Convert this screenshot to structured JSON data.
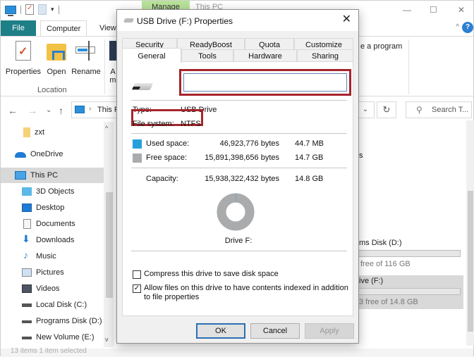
{
  "explorer": {
    "title_tab_contextual": "Manage",
    "title": "This PC",
    "quick_access_icons": [
      "this-pc-icon",
      "properties-icon",
      "new-folder-icon",
      "customize-qat-icon"
    ],
    "window_controls": {
      "minimize": "—",
      "maximize": "☐",
      "close": "✕"
    },
    "ribbon_tabs": [
      {
        "label": "File"
      },
      {
        "label": "Computer",
        "active": true
      },
      {
        "label": "View"
      }
    ],
    "ribbon": {
      "buttons": [
        {
          "label": "Properties",
          "icon": "properties-icon"
        },
        {
          "label": "Open",
          "icon": "open-folder-icon"
        },
        {
          "label": "Rename",
          "icon": "rename-icon"
        }
      ],
      "truncated_buttons": [
        "A",
        "m"
      ],
      "group_label": "Location",
      "program_text": "e a program"
    },
    "nav": {
      "back": "←",
      "forward": "→",
      "recent": "⌄",
      "up": "↑",
      "address_chevron": "›",
      "address_text": "This P",
      "address_dropdown": "⌄",
      "refresh": "↻",
      "search_placeholder": "Search T..."
    },
    "sidebar": {
      "items": [
        {
          "label": "zxt",
          "icon": "folder-icon"
        },
        {
          "label": "OneDrive",
          "icon": "onedrive-icon"
        },
        {
          "label": "This PC",
          "icon": "this-pc-icon",
          "selected": true
        },
        {
          "label": "3D Objects",
          "icon": "3d-objects-icon"
        },
        {
          "label": "Desktop",
          "icon": "desktop-icon"
        },
        {
          "label": "Documents",
          "icon": "documents-icon"
        },
        {
          "label": "Downloads",
          "icon": "downloads-icon"
        },
        {
          "label": "Music",
          "icon": "music-icon"
        },
        {
          "label": "Pictures",
          "icon": "pictures-icon"
        },
        {
          "label": "Videos",
          "icon": "videos-icon"
        },
        {
          "label": "Local Disk (C:)",
          "icon": "local-disk-icon"
        },
        {
          "label": "Programs Disk (D:)",
          "icon": "drive-icon"
        },
        {
          "label": "New Volume (E:)",
          "icon": "drive-icon"
        }
      ],
      "scroll_up": "^",
      "scroll_down": "v"
    },
    "main": {
      "partial_s": "s",
      "drives": [
        {
          "name": "ms Disk (D:)",
          "free": "free of 116 GB",
          "selected": false
        },
        {
          "name": "ive (F:)",
          "free": "3 free of 14.8 GB",
          "selected": true
        }
      ]
    },
    "status_bar": "13 items   1 item selected"
  },
  "dialog": {
    "title": "USB Drive (F:) Properties",
    "close": "✕",
    "tabs_back_row": [
      "Security",
      "ReadyBoost",
      "Quota",
      "Customize"
    ],
    "tabs_front_row": [
      "General",
      "Tools",
      "Hardware",
      "Sharing"
    ],
    "active_tab": "General",
    "general": {
      "volume_label_value": "",
      "type_label": "Type:",
      "type_value": "USB Drive",
      "fs_label": "File system:",
      "fs_value": "NTFS",
      "used_label": "Used space:",
      "used_bytes": "46,923,776 bytes",
      "used_size": "44.7 MB",
      "free_label": "Free space:",
      "free_bytes": "15,891,398,656 bytes",
      "free_size": "14.7 GB",
      "capacity_label": "Capacity:",
      "capacity_bytes": "15,938,322,432 bytes",
      "capacity_size": "14.8 GB",
      "used_color": "#26a0da",
      "free_color": "#a9abad",
      "used_fraction": 0.0029,
      "drive_caption": "Drive F:",
      "compress_label": "Compress this drive to save disk space",
      "compress_checked": false,
      "index_label": "Allow files on this drive to have contents indexed in addition to file properties",
      "index_checked": true
    },
    "buttons": {
      "ok": "OK",
      "cancel": "Cancel",
      "apply": "Apply"
    },
    "highlight_color": "#a6252b"
  }
}
